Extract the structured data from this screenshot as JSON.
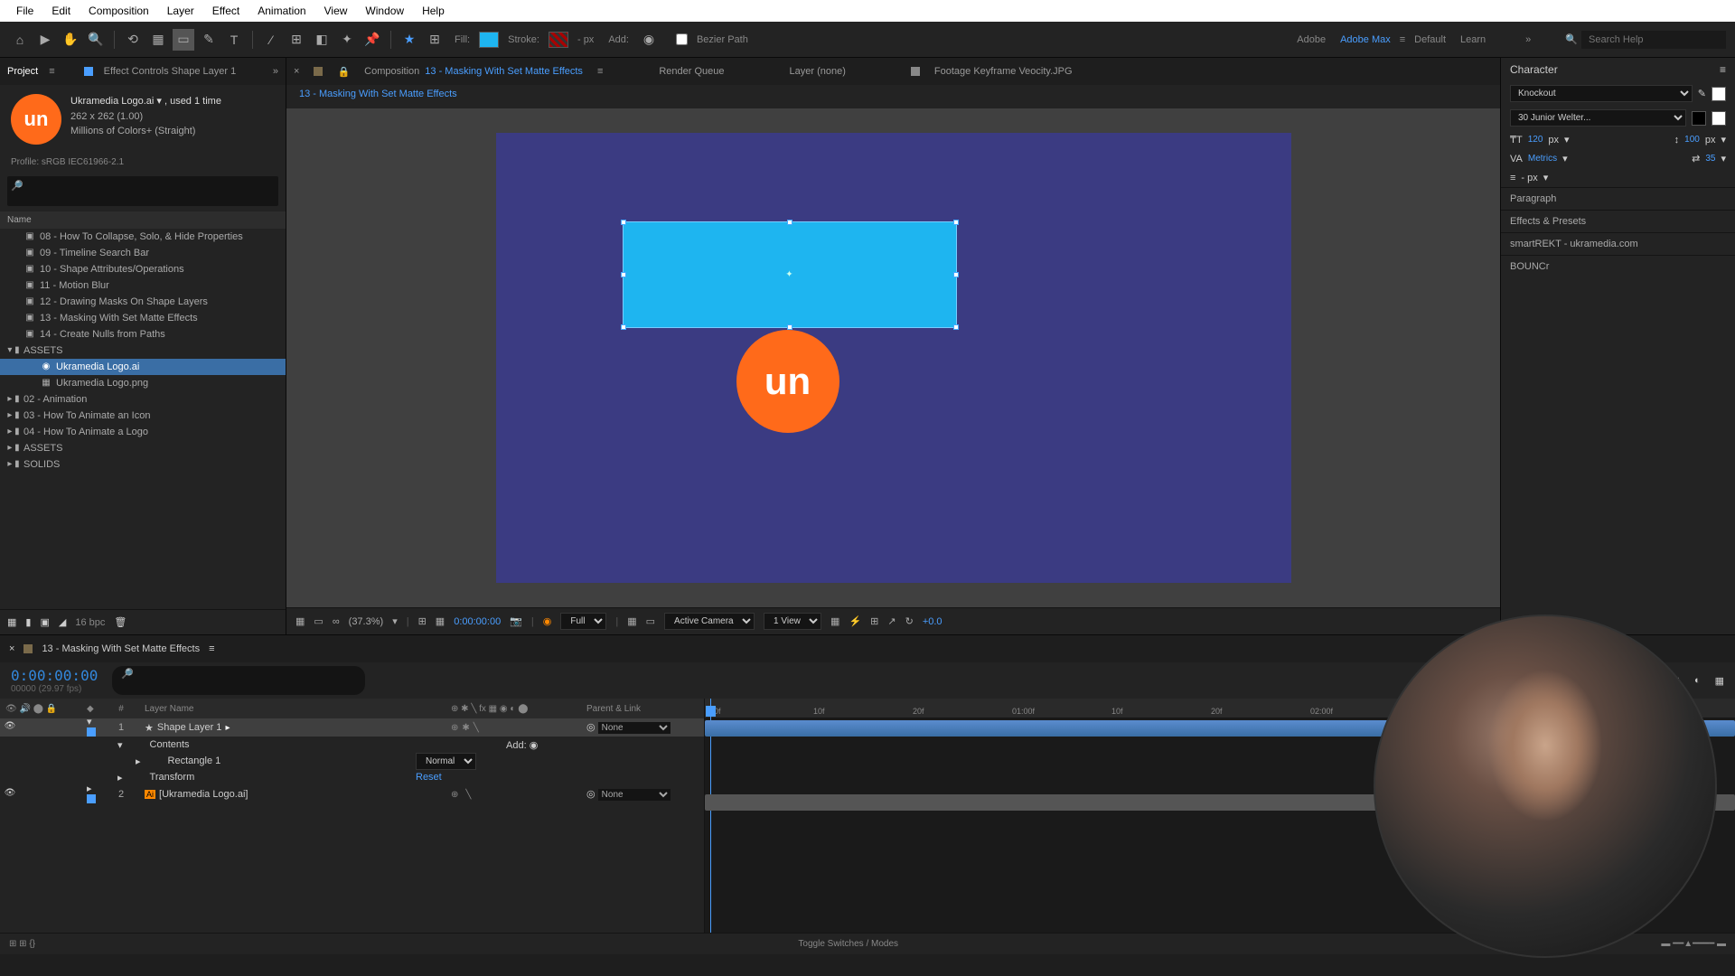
{
  "menu": {
    "items": [
      "File",
      "Edit",
      "Composition",
      "Layer",
      "Effect",
      "Animation",
      "View",
      "Window",
      "Help"
    ]
  },
  "toolbar": {
    "fill_label": "Fill:",
    "stroke_label": "Stroke:",
    "stroke_px": "- px",
    "add_label": "Add:",
    "bezier_label": "Bezier Path",
    "ws_adobe": "Adobe",
    "ws_max": "Adobe Max",
    "ws_default": "Default",
    "ws_learn": "Learn",
    "search_ph": "Search Help"
  },
  "project": {
    "tab_project": "Project",
    "tab_effect": "Effect Controls Shape Layer 1",
    "asset_name": "Ukramedia Logo.ai ▾ , used 1 time",
    "asset_dim": "262 x 262 (1.00)",
    "asset_colors": "Millions of Colors+ (Straight)",
    "profile": "Profile: sRGB IEC61966-2.1",
    "col_name": "Name",
    "items": [
      {
        "indent": 1,
        "icon": "▣",
        "name": "08 - How To Collapse, Solo, & Hide Properties"
      },
      {
        "indent": 1,
        "icon": "▣",
        "name": "09 - Timeline Search Bar"
      },
      {
        "indent": 1,
        "icon": "▣",
        "name": "10 - Shape Attributes/Operations"
      },
      {
        "indent": 1,
        "icon": "▣",
        "name": "11 - Motion Blur"
      },
      {
        "indent": 1,
        "icon": "▣",
        "name": "12 - Drawing Masks On Shape Layers"
      },
      {
        "indent": 1,
        "icon": "▣",
        "name": "13 - Masking With Set Matte Effects"
      },
      {
        "indent": 1,
        "icon": "▣",
        "name": "14 - Create Nulls from Paths"
      },
      {
        "indent": 0,
        "icon": "▾ ▮",
        "name": "ASSETS"
      },
      {
        "indent": 2,
        "icon": "◉",
        "name": "Ukramedia Logo.ai",
        "sel": true
      },
      {
        "indent": 2,
        "icon": "▦",
        "name": "Ukramedia Logo.png"
      },
      {
        "indent": 0,
        "icon": "▸ ▮",
        "name": "02 - Animation"
      },
      {
        "indent": 0,
        "icon": "▸ ▮",
        "name": "03 - How To Animate an Icon"
      },
      {
        "indent": 0,
        "icon": "▸ ▮",
        "name": "04 - How To Animate a Logo"
      },
      {
        "indent": 0,
        "icon": "▸ ▮",
        "name": "ASSETS"
      },
      {
        "indent": 0,
        "icon": "▸ ▮",
        "name": "SOLIDS"
      }
    ],
    "bpc": "16 bpc"
  },
  "comp": {
    "tab_prefix": "Composition",
    "name": "13 - Masking With Set Matte Effects",
    "render_queue": "Render Queue",
    "layer_none": "Layer (none)",
    "footage": "Footage Keyframe Veocity.JPG",
    "crumb": "13 - Masking With Set Matte Effects",
    "logo_text": "un"
  },
  "viewerFoot": {
    "zoom": "(37.3%)",
    "time": "0:00:00:00",
    "res": "Full",
    "camera": "Active Camera",
    "view": "1 View",
    "exposure": "+0.0"
  },
  "right": {
    "char_title": "Character",
    "font": "Knockout",
    "style": "30 Junior Welter...",
    "size_lbl": "₸T",
    "size_val": "120",
    "px": "px",
    "leading_val": "100",
    "kern_lbl": "VA",
    "kern_val": "Metrics",
    "track_val": "35",
    "p_dash": "- px",
    "paragraph": "Paragraph",
    "eff_presets": "Effects & Presets",
    "smartrekt": "smartREKT - ukramedia.com",
    "bouncr": "BOUNCr"
  },
  "timeline": {
    "tab": "13 - Masking With Set Matte Effects",
    "time": "0:00:00:00",
    "fps": "00000 (29.97 fps)",
    "col_num": "#",
    "col_name": "Layer Name",
    "col_parent": "Parent & Link",
    "rows": [
      {
        "num": "1",
        "name": "Shape Layer 1",
        "parent": "None",
        "sel": true,
        "color": "#4a9eff"
      },
      {
        "num": "2",
        "name": "[Ukramedia Logo.ai]",
        "parent": "None",
        "sel": false,
        "color": "#4a9eff"
      }
    ],
    "sub_contents": "Contents",
    "sub_add": "Add:",
    "sub_rect": "Rectangle 1",
    "sub_normal": "Normal",
    "sub_transform": "Transform",
    "sub_reset": "Reset",
    "ticks": [
      "0f",
      "10f",
      "20f",
      "01:00f",
      "10f",
      "20f",
      "02:00f"
    ],
    "toggle": "Toggle Switches / Modes"
  }
}
